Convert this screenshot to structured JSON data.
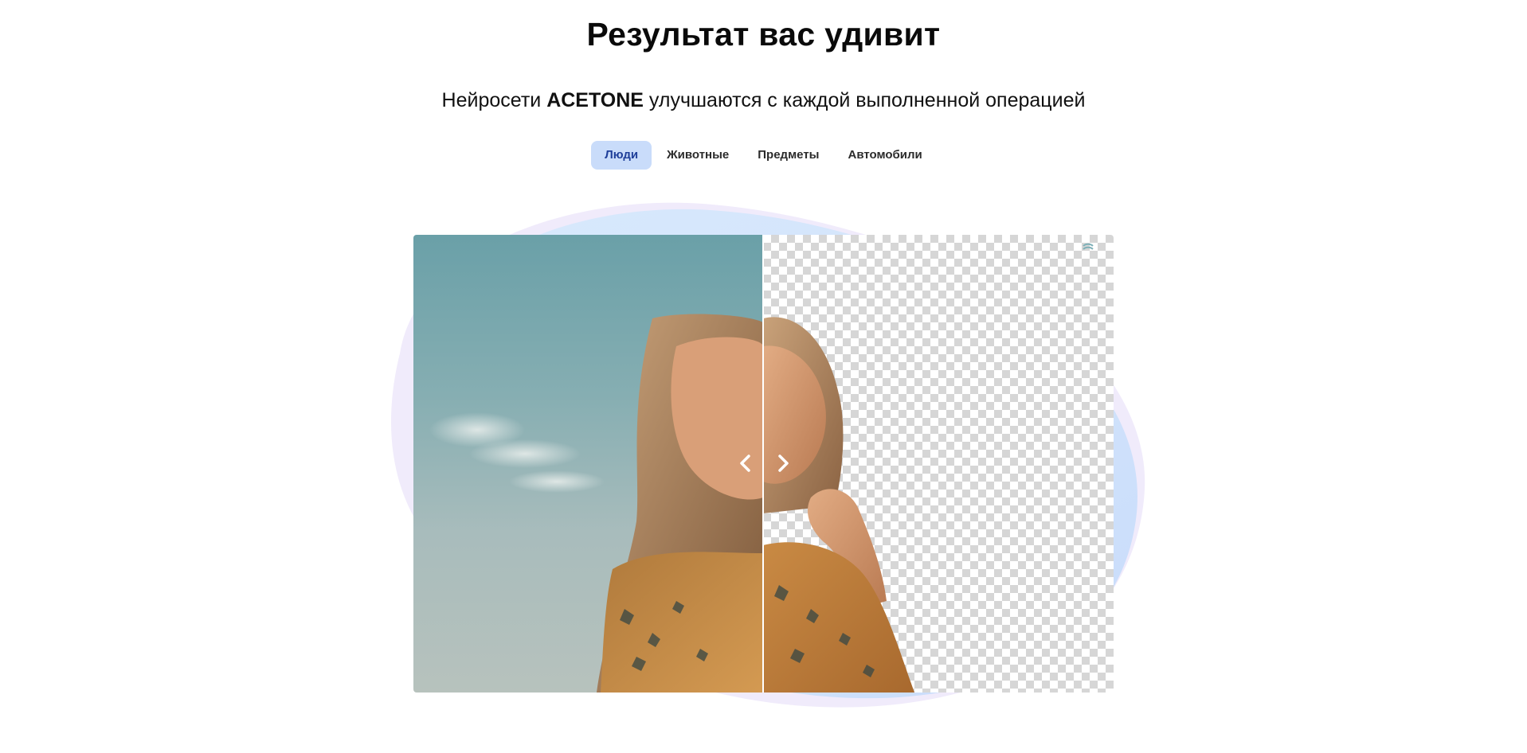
{
  "section": {
    "title": "Результат вас удивит",
    "subtitle_prefix": "Нейросети ",
    "subtitle_brand": "ACETONE",
    "subtitle_suffix": " улучшаются с каждой выполненной операцией"
  },
  "tabs": [
    {
      "label": "Люди",
      "active": true
    },
    {
      "label": "Животные",
      "active": false
    },
    {
      "label": "Предметы",
      "active": false
    },
    {
      "label": "Автомобили",
      "active": false
    }
  ],
  "comparison": {
    "before_icon": "chevron-left-icon",
    "after_icon": "chevron-right-icon",
    "split_position": 0.5
  },
  "colors": {
    "accent_tab_bg": "#c9dcfa",
    "accent_tab_text": "#1f3f9a",
    "blob_blue": "#cfe3fb",
    "blob_lilac": "#ece7fb"
  }
}
